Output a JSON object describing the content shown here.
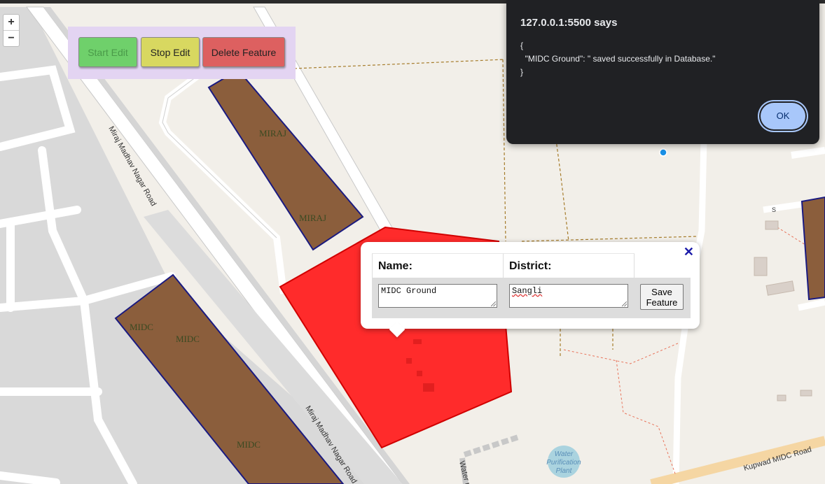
{
  "map": {
    "zoom_in": "+",
    "zoom_out": "−",
    "road_labels": {
      "miraj_madhav_upper": "Miraj Madhav Nagar Road",
      "miraj_madhav_lower": "Miraj Madhav Nagar Road",
      "kupwad": "Kupwad MIDC Road",
      "water_road": "Water r",
      "s_label": "S"
    },
    "poi": {
      "water_plant_line1": "Water",
      "water_plant_line2": "Purification",
      "water_plant_line3": "Plant"
    },
    "feature_labels": {
      "miraj_1": "MIRAJ",
      "miraj_2": "MIRAJ",
      "midc_1": "MIDC",
      "midc_2": "MIDC",
      "midc_3": "MIDC"
    },
    "colors": {
      "feature_fill": "#8b5e3c",
      "feature_stroke": "#1a1a80",
      "selected_fill": "#ff2b2b",
      "selected_stroke": "#d00000"
    }
  },
  "toolbar": {
    "start_edit": "Start Edit",
    "stop_edit": "Stop Edit",
    "delete_feature": "Delete Feature"
  },
  "popup": {
    "close": "✕",
    "name_header": "Name:",
    "district_header": "District:",
    "name_value": "MIDC Ground",
    "district_value": "Sangli",
    "save_line1": "Save",
    "save_line2": "Feature"
  },
  "dialog": {
    "title": "127.0.0.1:5500 says",
    "message": "{\n  \"MIDC Ground\": \" saved successfully in Database.\"\n}",
    "ok": "OK"
  }
}
